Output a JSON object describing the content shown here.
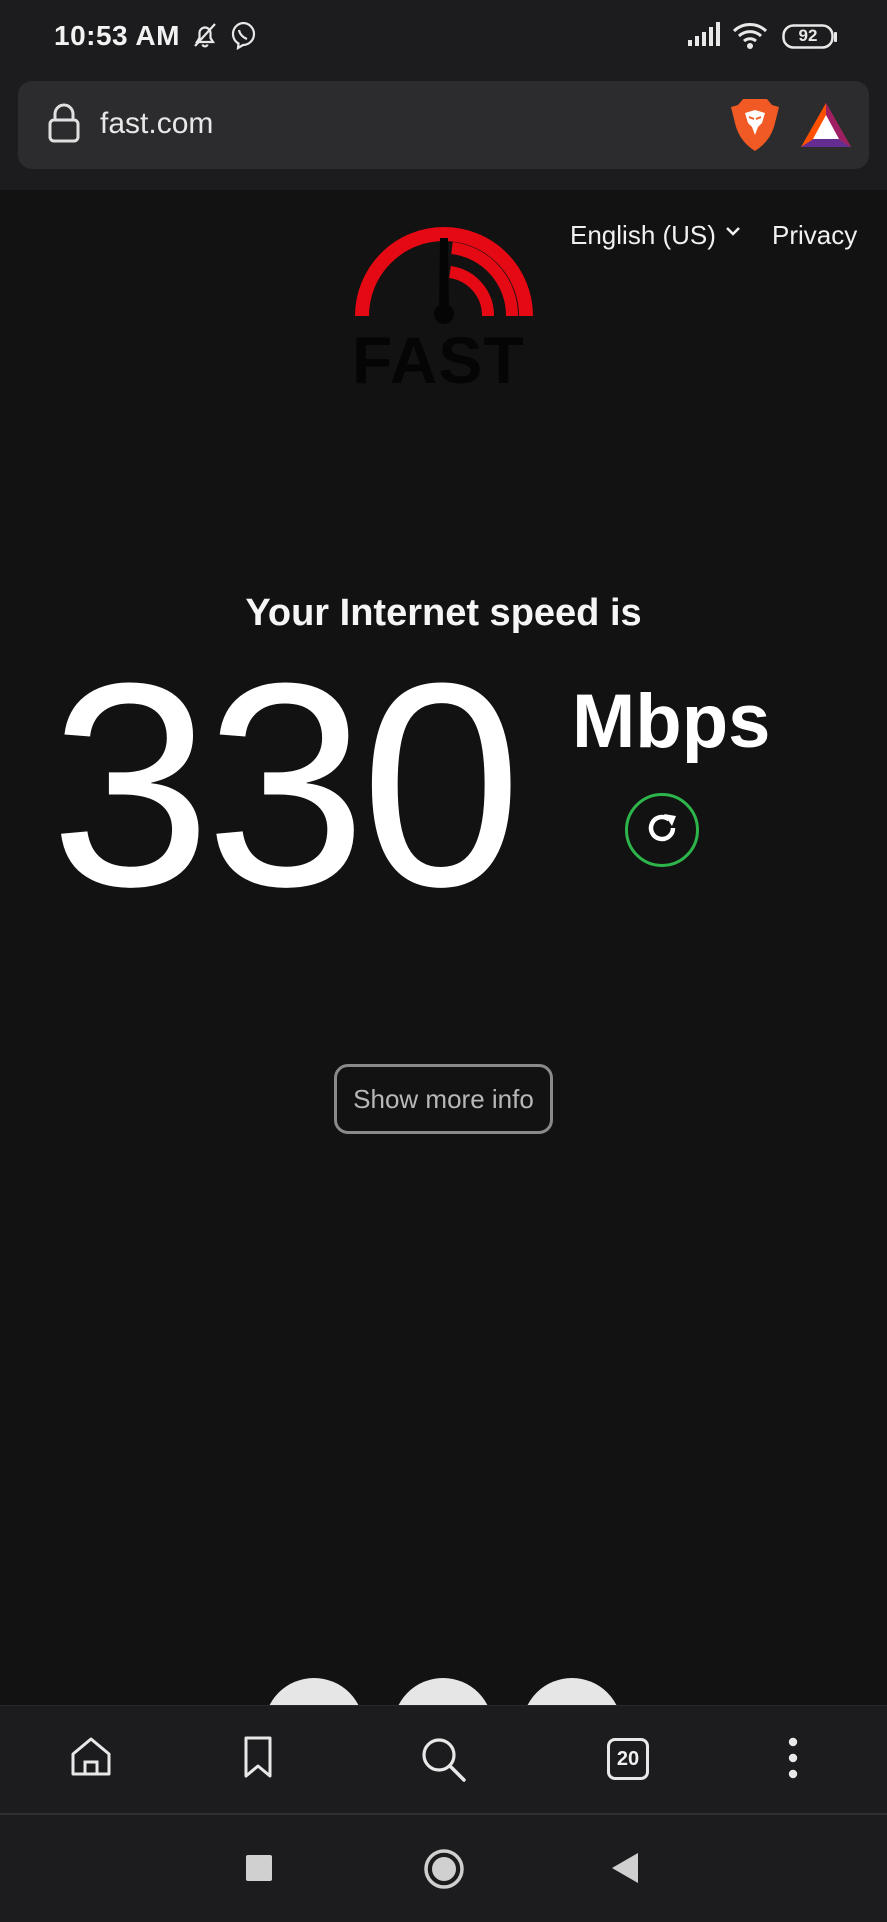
{
  "status_bar": {
    "time": "10:53 AM",
    "icons": [
      "bell-off-icon",
      "viber-icon",
      "signal-icon",
      "wifi-icon",
      "battery-icon"
    ],
    "battery": "92"
  },
  "browser": {
    "url": "fast.com",
    "icons": [
      "lock-icon",
      "brave-shields-icon",
      "brave-rewards-icon"
    ]
  },
  "page": {
    "language_label": "English (US)",
    "privacy_label": "Privacy",
    "logo_text": "FAST",
    "speed_label": "Your Internet speed is",
    "speed_value": "330",
    "speed_unit": "Mbps",
    "more_info_label": "Show more info"
  },
  "toolbar": {
    "tabs_count": "20",
    "icons": [
      "home-icon",
      "bookmark-icon",
      "search-icon",
      "tabs-icon",
      "more-menu-icon"
    ]
  },
  "navbar": {
    "icons": [
      "recents-icon",
      "home-nav-icon",
      "back-icon"
    ]
  },
  "colors": {
    "background": "#121212",
    "brand_red": "#e50914",
    "refresh_green": "#2db44a"
  }
}
